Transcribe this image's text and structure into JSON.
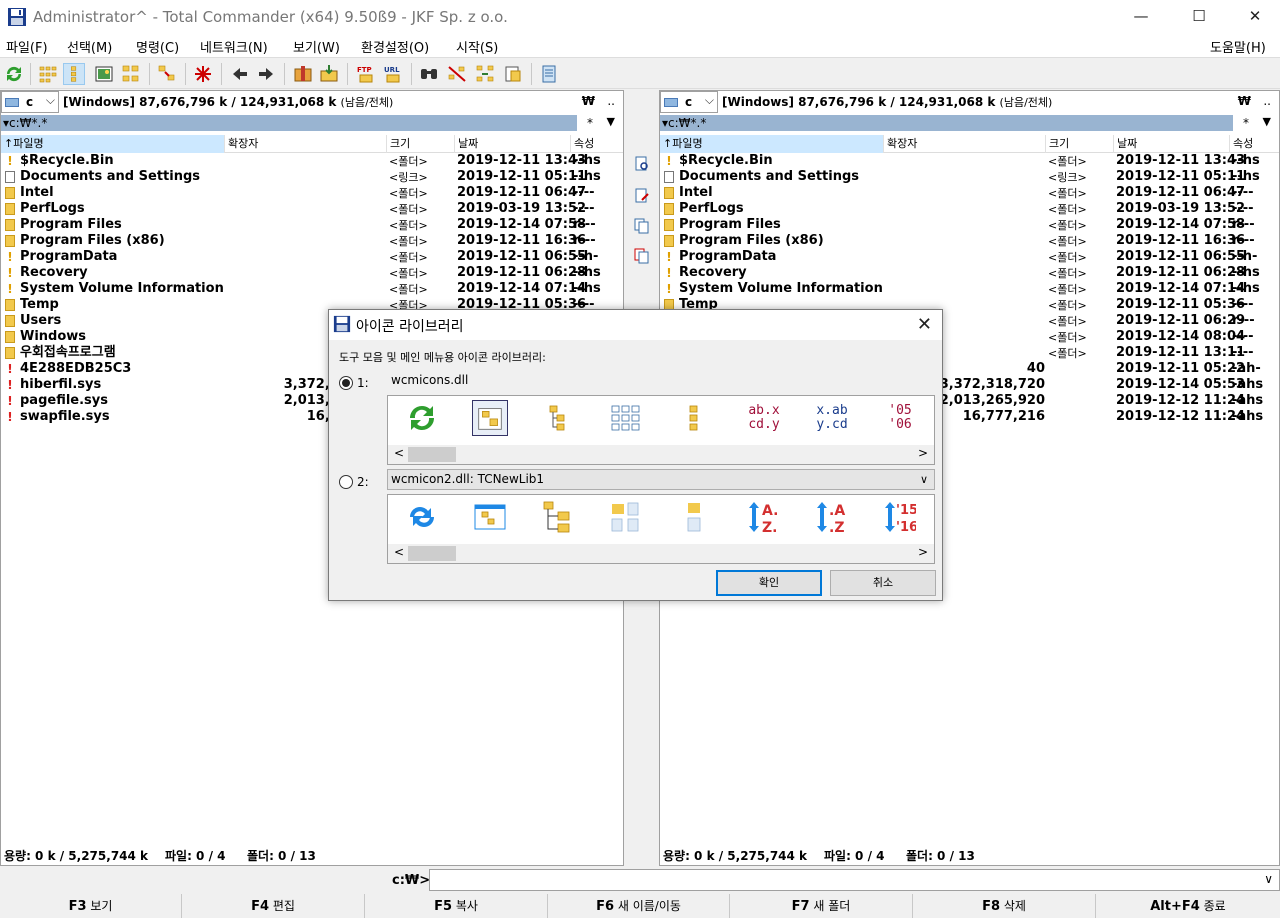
{
  "window": {
    "title": "Administrator^ - Total Commander (x64) 9.50ß9 - JKF Sp. z o.o.",
    "minimize": "—",
    "maximize": "☐",
    "close": "✕"
  },
  "menu": [
    {
      "label": "파일(F)"
    },
    {
      "label": "선택(M)"
    },
    {
      "label": "명령(C)"
    },
    {
      "label": "네트워크(N)"
    },
    {
      "label": "보기(W)"
    },
    {
      "label": "환경설정(O)"
    },
    {
      "label": "시작(S)"
    }
  ],
  "menu_help": "도움말(H)",
  "left": {
    "drive": "c",
    "diskinfo": "[Windows]  87,676,796 k / 124,931,068 k",
    "diskinfo_suffix": "(남음/전체)",
    "root": "₩",
    "up": "..",
    "path": "▾c:₩*.*",
    "pathstar": "*",
    "pathdown": "▼",
    "cols": {
      "name": "↑파일명",
      "ext": "확장자",
      "size": "크기",
      "date": "날짜",
      "attr": "속성"
    },
    "status": {
      "used": "용량: 0 k / 5,275,744 k",
      "files": "파일: 0 / 4",
      "folders": "폴더: 0 / 13"
    }
  },
  "right": {
    "drive": "c",
    "diskinfo": "[Windows]  87,676,796 k / 124,931,068 k",
    "diskinfo_suffix": "(남음/전체)",
    "root": "₩",
    "up": "..",
    "path": "▾c:₩*.*",
    "pathstar": "*",
    "pathdown": "▼",
    "cols": {
      "name": "↑파일명",
      "ext": "확장자",
      "size": "크기",
      "date": "날짜",
      "attr": "속성"
    },
    "status": {
      "used": "용량: 0 k / 5,275,744 k",
      "files": "파일: 0 / 4",
      "folders": "폴더: 0 / 13"
    }
  },
  "files": [
    {
      "name": "$Recycle.Bin",
      "size": "<폴더>",
      "date": "2019-12-11 13:43",
      "attr": "--hs",
      "icon": "warn-folder"
    },
    {
      "name": "Documents and Settings",
      "size": "<링크>",
      "date": "2019-12-11 05:11",
      "attr": "--hs",
      "icon": "link"
    },
    {
      "name": "Intel",
      "size": "<폴더>",
      "date": "2019-12-11 06:47",
      "attr": "----",
      "icon": "folder"
    },
    {
      "name": "PerfLogs",
      "size": "<폴더>",
      "date": "2019-03-19 13:52",
      "attr": "----",
      "icon": "folder"
    },
    {
      "name": "Program Files",
      "size": "<폴더>",
      "date": "2019-12-14 07:58",
      "attr": "r---",
      "icon": "folder"
    },
    {
      "name": "Program Files (x86)",
      "size": "<폴더>",
      "date": "2019-12-11 16:36",
      "attr": "r---",
      "icon": "folder"
    },
    {
      "name": "ProgramData",
      "size": "<폴더>",
      "date": "2019-12-11 06:55",
      "attr": "--h-",
      "icon": "warn-folder"
    },
    {
      "name": "Recovery",
      "size": "<폴더>",
      "date": "2019-12-11 06:28",
      "attr": "--hs",
      "icon": "warn-folder"
    },
    {
      "name": "System Volume Information",
      "size": "<폴더>",
      "date": "2019-12-14 07:14",
      "attr": "--hs",
      "icon": "warn-folder"
    },
    {
      "name": "Temp",
      "size": "<폴더>",
      "date": "2019-12-11 05:36",
      "attr": "----",
      "icon": "folder"
    },
    {
      "name": "Users",
      "size": "<폴더>",
      "date": "2019-12-11 06:29",
      "attr": "r---",
      "icon": "folder"
    },
    {
      "name": "Windows",
      "size": "<폴더>",
      "date": "2019-12-14 08:04",
      "attr": "----",
      "icon": "folder"
    },
    {
      "name": "우회접속프로그램",
      "size": "<폴더>",
      "date": "2019-12-11 13:11",
      "attr": "----",
      "icon": "folder"
    },
    {
      "name": "4E288EDB25C3",
      "size": "40",
      "date": "2019-12-11 05:22",
      "attr": "-ah-",
      "icon": "warn-file"
    },
    {
      "name": "hiberfil.sys",
      "size": "3,372,318,720",
      "date": "2019-12-14 05:53",
      "attr": "-ahs",
      "icon": "warn-file"
    },
    {
      "name": "pagefile.sys",
      "size": "2,013,265,920",
      "date": "2019-12-12 11:24",
      "attr": "-ahs",
      "icon": "warn-file"
    },
    {
      "name": "swapfile.sys",
      "size": "16,777,216",
      "date": "2019-12-12 11:24",
      "attr": "-ahs",
      "icon": "warn-file"
    }
  ],
  "cmdline": {
    "label": "c:₩>",
    "value": "",
    "arrow": "∨"
  },
  "fkeys": [
    {
      "key": "F3",
      "label": "보기"
    },
    {
      "key": "F4",
      "label": "편집"
    },
    {
      "key": "F5",
      "label": "복사"
    },
    {
      "key": "F6",
      "label": "새 이름/이동"
    },
    {
      "key": "F7",
      "label": "새 폴더"
    },
    {
      "key": "F8",
      "label": "삭제"
    },
    {
      "key": "Alt+F4",
      "label": "종료"
    }
  ],
  "dialog": {
    "title": "아이콘 라이브러리",
    "close": "✕",
    "desc": "도구 모음 및 메인 메뉴용 아이콘 라이브러리:",
    "opt1_label": "1:",
    "opt1_name": "wcmicons.dll",
    "opt2_label": "2:",
    "opt2_value": "wcmicon2.dll: TCNewLib1",
    "combo_arrow": "∨",
    "scroll_left": "<",
    "scroll_right": ">",
    "lib1_text": {
      "abx1": "ab.x",
      "abx2": "cd.y",
      "xab1": "x.ab",
      "xab2": "y.cd",
      "y1": "'05",
      "y2": "'06"
    },
    "lib2_text": {
      "az1": "A.",
      "az2": "Z.",
      "za1": ".A",
      "za2": ".Z",
      "y1": "'15",
      "y2": "'16"
    },
    "ok": "확인",
    "cancel": "취소"
  },
  "colors": {
    "path_bar": "#99b4d1",
    "header_active": "#cce8ff",
    "folder": "#f2c94c",
    "accent": "#0078d7"
  }
}
